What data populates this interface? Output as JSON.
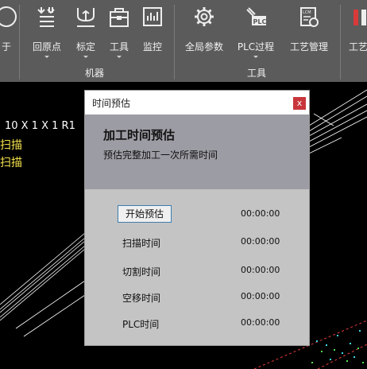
{
  "ribbon": {
    "partial_left_label": "于",
    "buttons": [
      {
        "label": "回原点",
        "icon": "home-origin-icon"
      },
      {
        "label": "标定",
        "icon": "calibrate-icon"
      },
      {
        "label": "工具",
        "icon": "toolbox-icon"
      },
      {
        "label": "监控",
        "icon": "monitor-icon"
      },
      {
        "label": "全局参数",
        "icon": "gear-icon"
      },
      {
        "label": "PLC过程",
        "icon": "plc-icon"
      },
      {
        "label": "工艺管理",
        "icon": "lcm-process-icon"
      },
      {
        "label": "工艺",
        "icon": "craft-icon"
      }
    ],
    "groups": {
      "machine": "机器",
      "tools": "工具"
    }
  },
  "canvas": {
    "line1": "10 X 1 X 1  R1",
    "line2": "扫描",
    "line3": "扫描"
  },
  "dialog": {
    "title": "时间预估",
    "close": "x",
    "heading": "加工时间预估",
    "subheading": "预估完整加工一次所需时间",
    "start_button": "开始预估",
    "start_value": "00:00:00",
    "rows": [
      {
        "label": "扫描时间",
        "value": "00:00:00"
      },
      {
        "label": "切割时间",
        "value": "00:00:00"
      },
      {
        "label": "空移时间",
        "value": "00:00:00"
      },
      {
        "label": "PLC时间",
        "value": "00:00:00"
      }
    ]
  },
  "colors": {
    "ribbon": "#5b5b5b",
    "dialog_body": "#c4c4c4",
    "dialog_header": "#9c9ca4",
    "close": "#c8363b",
    "scan_text": "#f3e14a"
  }
}
